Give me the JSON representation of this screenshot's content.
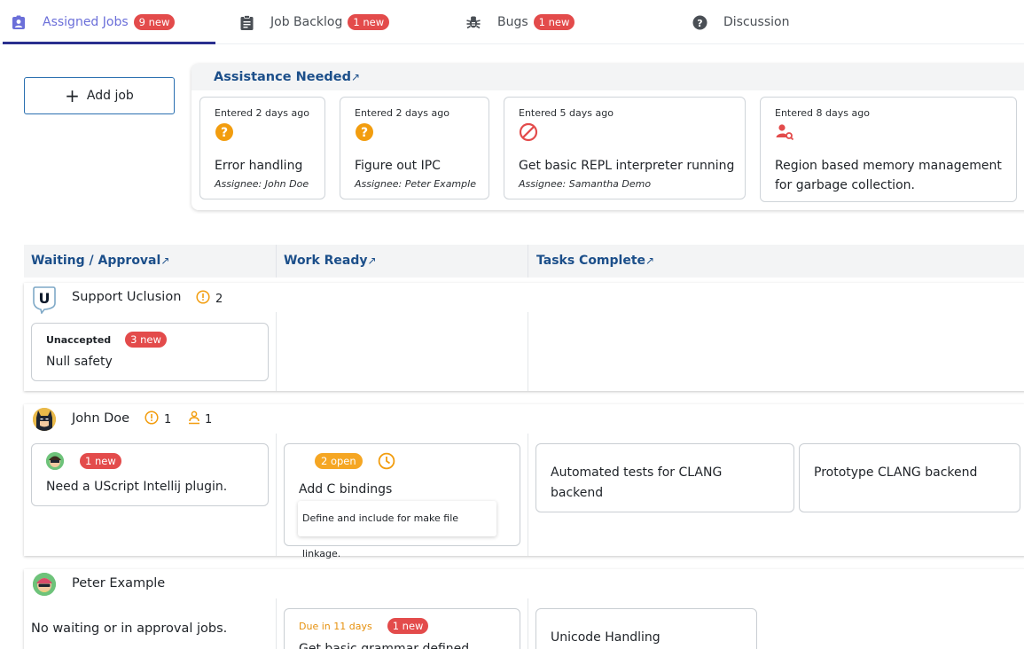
{
  "tabs": [
    {
      "label": "Assigned Jobs",
      "badge": "9 new"
    },
    {
      "label": "Job Backlog",
      "badge": "1 new"
    },
    {
      "label": "Bugs",
      "badge": "1 new"
    },
    {
      "label": "Discussion"
    }
  ],
  "add_job_label": "Add job",
  "assistance": {
    "title": "Assistance Needed",
    "arrow": "↗",
    "cards": [
      {
        "entered": "Entered 2 days ago",
        "icon": "question-icon",
        "title": "Error handling",
        "assignee": "Assignee: John Doe"
      },
      {
        "entered": "Entered 2 days ago",
        "icon": "question-icon",
        "title": "Figure out IPC",
        "assignee": "Assignee: Peter Example"
      },
      {
        "entered": "Entered 5 days ago",
        "icon": "blocked-icon",
        "title": "Get basic REPL interpreter running",
        "assignee": "Assignee: Samantha Demo"
      },
      {
        "entered": "Entered 8 days ago",
        "icon": "person-search-icon",
        "title_line1": "Region based memory management",
        "title_line2": "for garbage collection."
      }
    ]
  },
  "columns": [
    {
      "label": "Waiting / Approval"
    },
    {
      "label": "Work Ready"
    },
    {
      "label": "Tasks Complete"
    }
  ],
  "lanes": {
    "support": {
      "name": "Support Uclusion",
      "warning_count": "2",
      "card": {
        "status": "Unaccepted",
        "badge": "3 new",
        "title": "Null safety"
      }
    },
    "john": {
      "name": "John Doe",
      "warning_count": "1",
      "assist_count": "1",
      "waiting_card": {
        "badge": "1 new",
        "title": "Need a UScript Intellij plugin."
      },
      "ready_card": {
        "badge": "2 open",
        "title": "Add C bindings",
        "note": "Define and include for make file linkage."
      },
      "complete": [
        {
          "line1": "Automated tests for CLANG",
          "line2": "backend"
        },
        {
          "line1": "Prototype CLANG backend"
        }
      ]
    },
    "peter": {
      "name": "Peter Example",
      "empty_text": "No waiting or in approval jobs.",
      "ready_card": {
        "due": "Due in 11 days",
        "badge": "1 new",
        "title": "Get basic grammar defined"
      },
      "complete": [
        {
          "line1": "Unicode Handling"
        }
      ]
    }
  },
  "colors": {
    "accent": "#6b6fd9",
    "link": "#1c4f8a",
    "badge": "#e34b4b",
    "warning": "#f5a623"
  }
}
